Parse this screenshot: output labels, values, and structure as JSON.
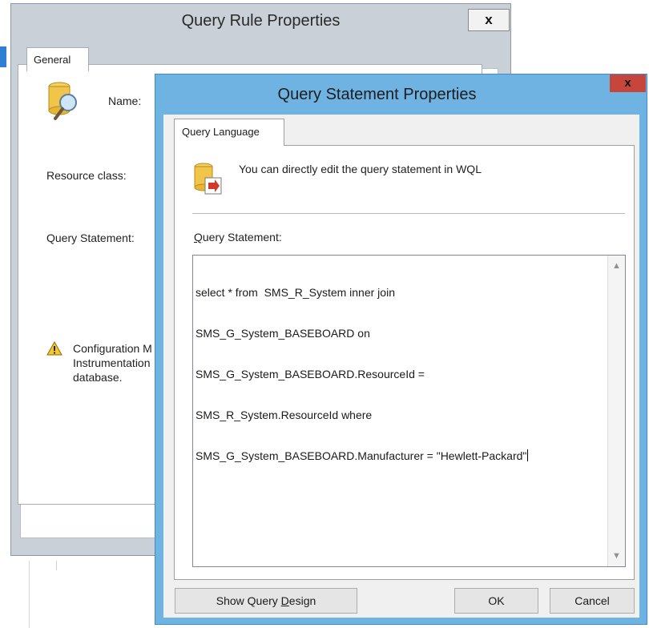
{
  "back_dialog": {
    "title": "Query Rule Properties",
    "close_label": "x",
    "tab_general": "General",
    "name_label": "Name:",
    "resource_class_label": "Resource class:",
    "query_statement_label": "Query Statement:",
    "warning_lines": [
      "Configuration M",
      "Instrumentation",
      "database."
    ]
  },
  "front_dialog": {
    "title": "Query Statement Properties",
    "close_label": "x",
    "tab_query_language": "Query Language",
    "info_text": "You can directly edit the query statement in WQL",
    "query_statement_label_prefix": "Q",
    "query_statement_label_rest": "uery Statement:",
    "query_lines": [
      "select * from  SMS_R_System inner join",
      "SMS_G_System_BASEBOARD on",
      "SMS_G_System_BASEBOARD.ResourceId =",
      "SMS_R_System.ResourceId where",
      "SMS_G_System_BASEBOARD.Manufacturer = \"Hewlett-Packard\""
    ],
    "buttons": {
      "show_query_design_pre": "Show Query ",
      "show_query_design_accel": "D",
      "show_query_design_post": "esign",
      "ok": "OK",
      "cancel": "Cancel"
    }
  },
  "icons": {
    "database_magnifier": "database-magnifier-icon",
    "database_arrow": "database-arrow-icon",
    "warning": "warning-icon"
  },
  "colors": {
    "front_frame": "#6fb3e3",
    "close_red": "#c7463b",
    "back_frame": "#c9d0d8"
  }
}
